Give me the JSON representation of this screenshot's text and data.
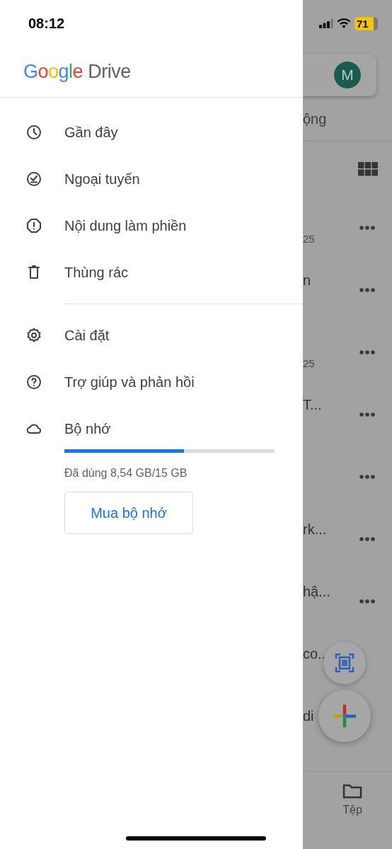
{
  "status_bar": {
    "time": "08:12",
    "battery": "71"
  },
  "drawer": {
    "logo": {
      "brand": "Google",
      "product": "Drive"
    },
    "sections": [
      {
        "items": [
          {
            "kind": "clock",
            "label": "Gần đây"
          },
          {
            "kind": "offline",
            "label": "Ngoại tuyến"
          },
          {
            "kind": "spam",
            "label": "Nội dung làm phiền"
          },
          {
            "kind": "trash",
            "label": "Thùng rác"
          }
        ]
      },
      {
        "items": [
          {
            "kind": "settings",
            "label": "Cài đặt"
          },
          {
            "kind": "help",
            "label": "Trợ giúp và phản hồi"
          },
          {
            "kind": "cloud",
            "label": "Bộ nhớ"
          }
        ]
      }
    ],
    "storage": {
      "level": 0.57,
      "usage": "Đã dùng 8,54 GB/15 GB",
      "button": "Mua bộ nhớ"
    }
  },
  "background": {
    "avatar": "M",
    "tab": "ộng",
    "rows": [
      {
        "subtitle": "25",
        "menu": true
      },
      {
        "title": "n",
        "menu": true
      },
      {
        "subtitle": "25",
        "menu": true
      },
      {
        "title": "T...",
        "menu": true
      },
      {
        "menu": true
      },
      {
        "title": "rk...",
        "menu": true
      },
      {
        "title": "hậ...",
        "menu": true
      },
      {
        "title": "co..",
        "menu": false
      },
      {
        "title": "di",
        "menu": false
      }
    ],
    "nav": [
      {
        "label": "Tệp"
      }
    ]
  }
}
